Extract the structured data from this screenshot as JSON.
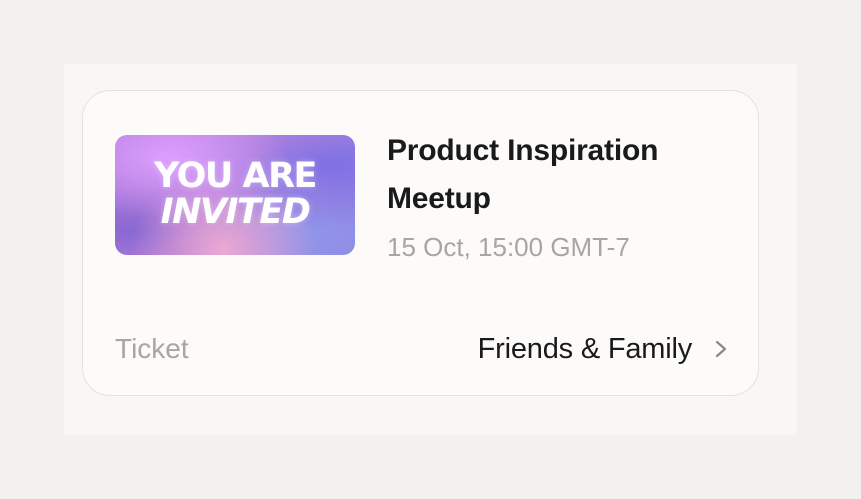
{
  "event": {
    "banner_line1": "YOU ARE",
    "banner_line2": "INVITED",
    "title": "Product Inspiration Meetup",
    "date": "15 Oct, 15:00 GMT-7"
  },
  "ticket": {
    "label": "Ticket",
    "value": "Friends & Family",
    "icon": "chevron-right-icon"
  },
  "colors": {
    "background": "#f3f1ef",
    "card": "#fcfbfa",
    "primary_text": "#1a1a1a",
    "secondary_text": "#a8a5a2"
  }
}
